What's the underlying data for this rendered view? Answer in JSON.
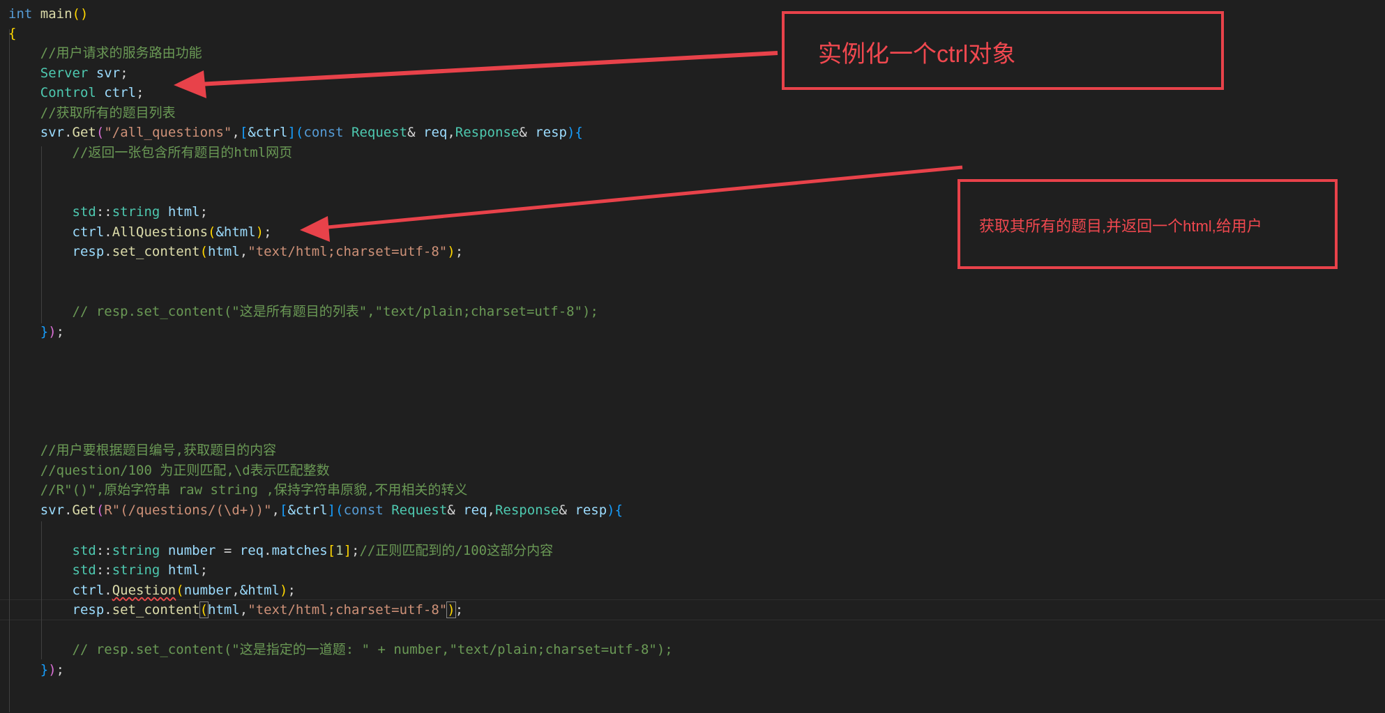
{
  "code": {
    "l_main_kw": "int",
    "l_main_fn": "main",
    "l_main_paren": "()",
    "l_open_brace": "{",
    "c_route": "//用户请求的服务路由功能",
    "server_type": "Server",
    "server_var": "svr",
    "control_type": "Control",
    "control_var": "ctrl",
    "c_all": "//获取所有的题目列表",
    "svr1": "svr",
    "get1": "Get",
    "path1": "\"/all_questions\"",
    "ctrl_cap": "&ctrl",
    "const_kw": "const",
    "request_type": "Request",
    "req_var": "req",
    "response_type": "Response",
    "resp_var": "resp",
    "c_return_html": "//返回一张包含所有题目的html网页",
    "std_ns": "std",
    "string_type": "string",
    "html_var": "html",
    "ctrl1": "ctrl",
    "allq_fn": "AllQuestions",
    "amp_html": "&html",
    "resp1": "resp",
    "set_content": "set_content",
    "mime_html": "\"text/html;charset=utf-8\"",
    "c_resp_plain": "// resp.set_content(\"这是所有题目的列表\",\"text/plain;charset=utf-8\");",
    "c_user_number": "//用户要根据题目编号,获取题目的内容",
    "c_regex": "//question/100 为正则匹配,\\d表示匹配整数",
    "c_raw": "//R\"()\",原始字符串 raw string ,保持字符串原貌,不用相关的转义",
    "path2": "R\"(/questions/(\\d+))\"",
    "number_var": "number",
    "matches": "matches",
    "one": "1",
    "c_match_comment": "//正则匹配到的/100这部分内容",
    "question_fn": "Question",
    "c_resp_plain2": "// resp.set_content(\"这是指定的一道题: \" + number,\"text/plain;charset=utf-8\");"
  },
  "annotations": {
    "callout1_text": "实例化一个ctrl对象",
    "callout2_text": "获取其所有的题目,并返回一个html,给用户",
    "color": "#e8424a"
  }
}
